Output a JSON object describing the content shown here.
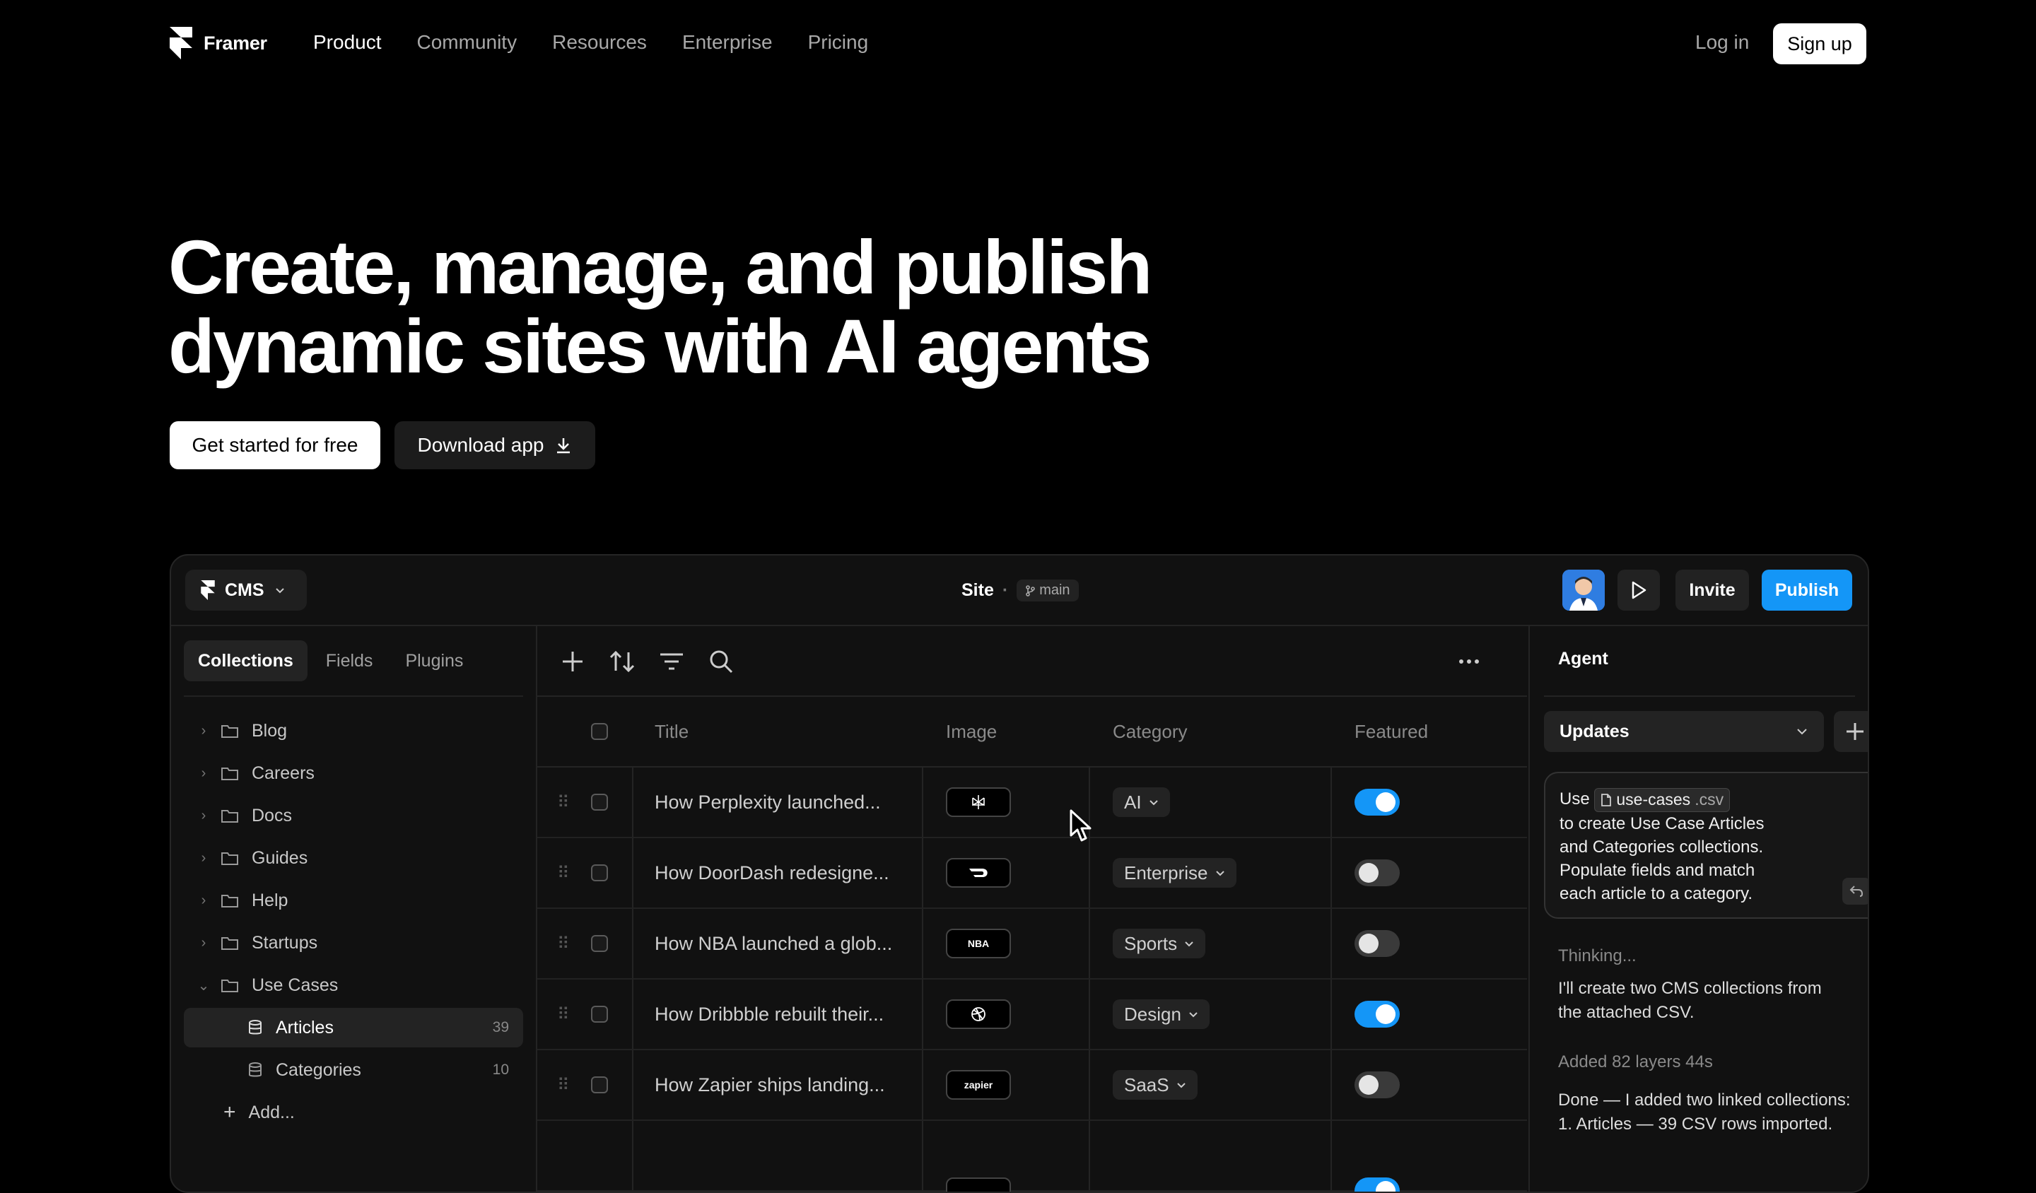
{
  "nav": {
    "brand": "Framer",
    "links": [
      "Product",
      "Community",
      "Resources",
      "Enterprise",
      "Pricing"
    ],
    "login": "Log in",
    "signup": "Sign up"
  },
  "hero": {
    "title": "Create, manage, and publish\ndynamic sites with AI agents",
    "cta_primary": "Get started for free",
    "cta_secondary": "Download app"
  },
  "app": {
    "cms_label": "CMS",
    "site_label": "Site",
    "branch": "main",
    "invite": "Invite",
    "publish": "Publish",
    "sidebar": {
      "tabs": [
        "Collections",
        "Fields",
        "Plugins"
      ],
      "items": [
        {
          "label": "Blog"
        },
        {
          "label": "Careers"
        },
        {
          "label": "Docs"
        },
        {
          "label": "Guides"
        },
        {
          "label": "Help"
        },
        {
          "label": "Startups"
        },
        {
          "label": "Use Cases"
        }
      ],
      "sub_items": [
        {
          "label": "Articles",
          "count": "39"
        },
        {
          "label": "Categories",
          "count": "10"
        }
      ],
      "add_label": "Add..."
    },
    "table": {
      "columns": [
        "Title",
        "Image",
        "Category",
        "Featured"
      ],
      "rows": [
        {
          "title": "How Perplexity launched...",
          "image": "perplexity-logo",
          "category": "AI",
          "featured": true
        },
        {
          "title": "How DoorDash redesigne...",
          "image": "doordash-logo",
          "category": "Enterprise",
          "featured": false
        },
        {
          "title": "How NBA launched a glob...",
          "image": "NBA",
          "category": "Sports",
          "featured": false
        },
        {
          "title": "How Dribbble rebuilt their...",
          "image": "dribbble-logo",
          "category": "Design",
          "featured": true
        },
        {
          "title": "How Zapier ships landing...",
          "image": "zapier",
          "category": "SaaS",
          "featured": false
        }
      ]
    },
    "agent": {
      "title": "Agent",
      "select_value": "Updates",
      "prompt_prefix": "Use",
      "file_name": "use-cases",
      "file_ext": ".csv",
      "prompt_body": "to create Use Case Articles and Categories collections. Populate fields and match each article to a category.",
      "thinking": "Thinking...",
      "reply": "I'll create two CMS collections from the attached CSV.",
      "added": "Added 82 layers 44s",
      "done": "Done — I added two linked collections:",
      "done_item": "1. Articles — 39 CSV rows imported."
    },
    "accent_color": "#1496f7"
  }
}
